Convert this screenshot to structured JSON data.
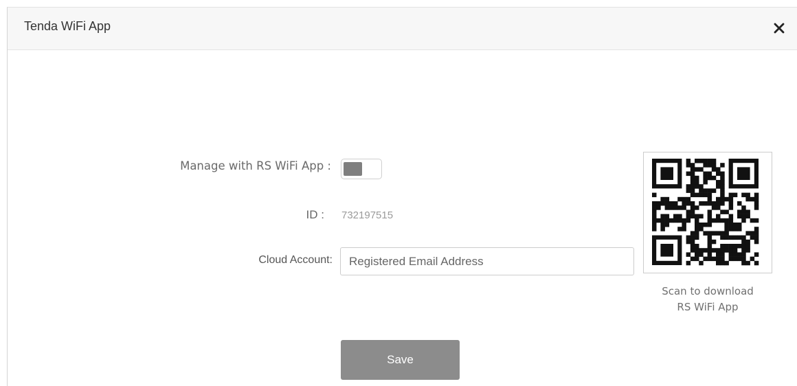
{
  "dialog": {
    "title": "Tenda WiFi App",
    "close_icon": "close-icon"
  },
  "form": {
    "manage_label": "Manage with RS WiFi App :",
    "manage_enabled": false,
    "id_label": "ID :",
    "id_value": "732197515",
    "cloud_label": "Cloud Account:",
    "cloud_placeholder": "Registered Email Address",
    "cloud_value": ""
  },
  "qr": {
    "caption_line1": "Scan to download",
    "caption_line2": "RS WiFi App"
  },
  "actions": {
    "save_label": "Save"
  },
  "colors": {
    "save_button": "#8c8c8c",
    "toggle_knob": "#7f7f7f",
    "header_bg": "#f7f7f7"
  }
}
